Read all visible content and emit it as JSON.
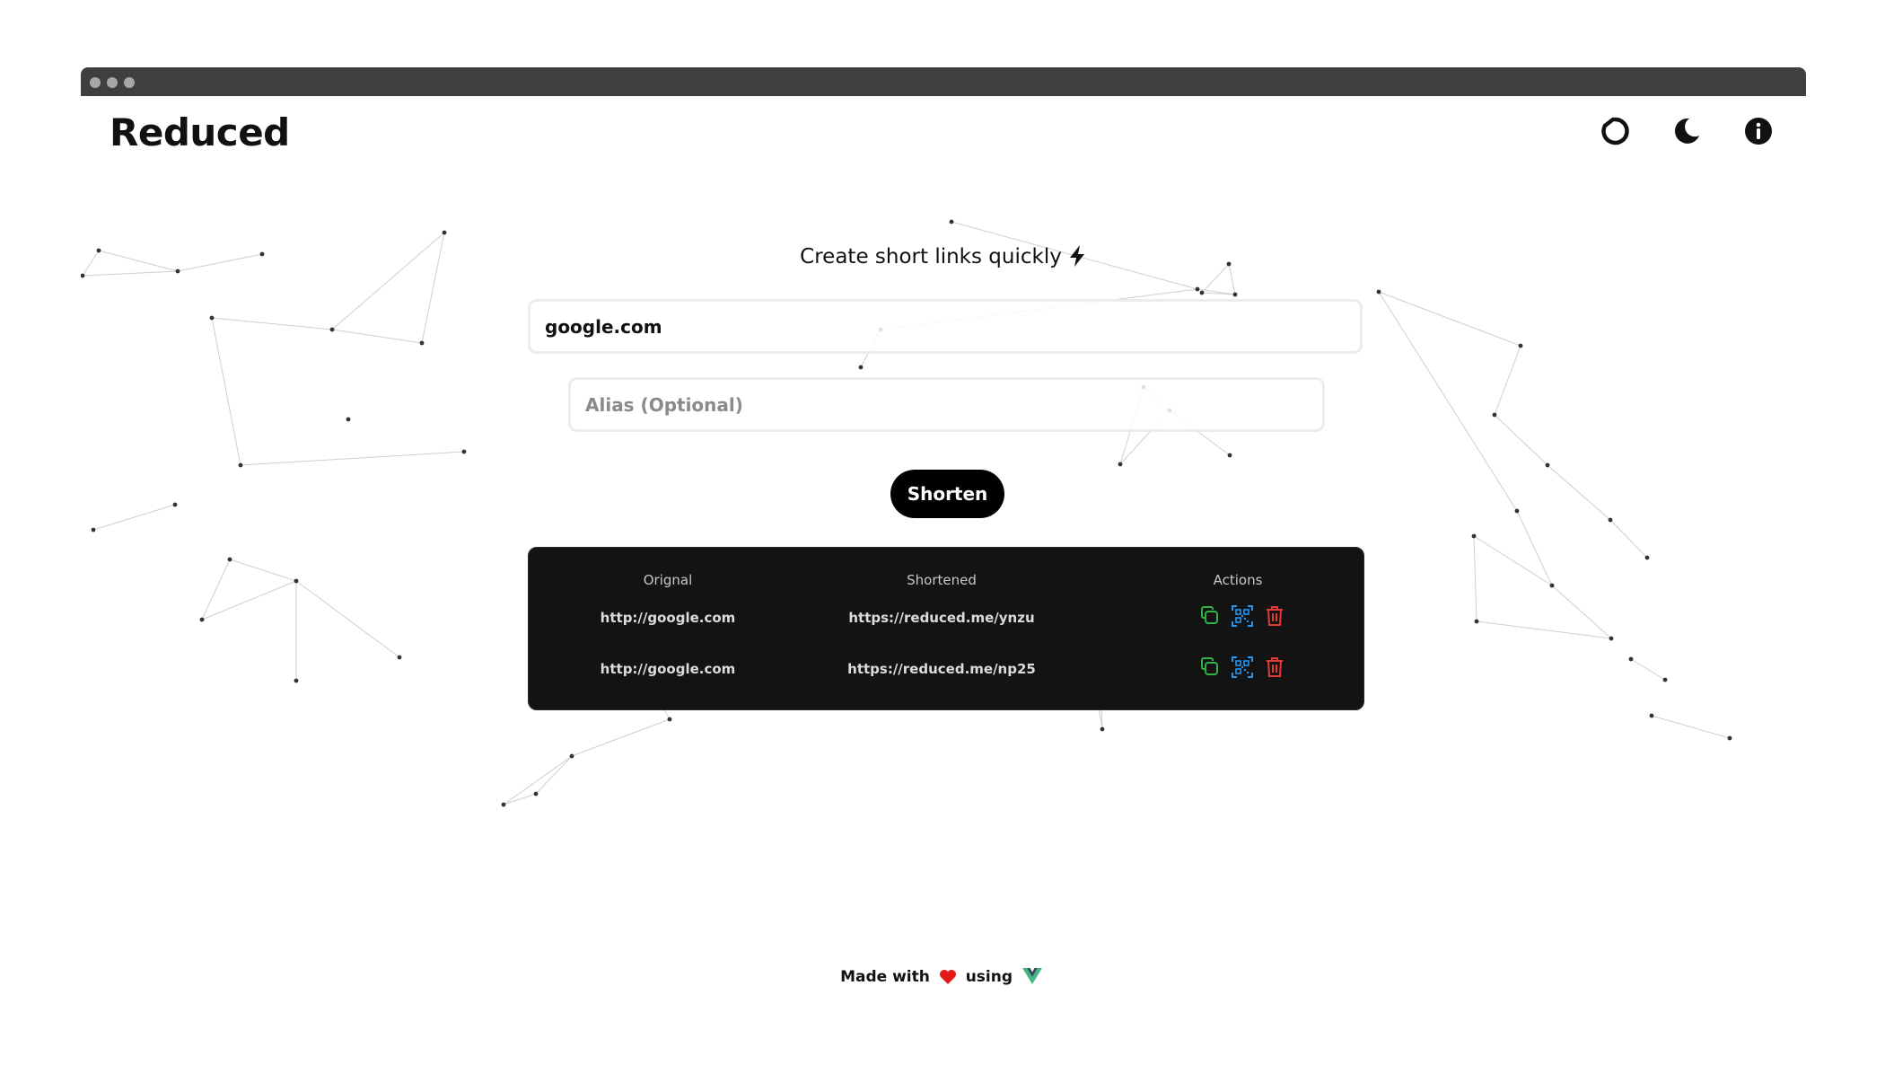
{
  "browser": {
    "window_dots": 3
  },
  "header": {
    "brand": "Reduced",
    "icons": [
      "refresh-icon",
      "moon-icon",
      "info-icon"
    ]
  },
  "hero": {
    "tagline": "Create short links quickly"
  },
  "form": {
    "url_value": "google.com",
    "alias_placeholder": "Alias (Optional)",
    "shorten_label": "Shorten"
  },
  "table": {
    "headers": {
      "original": "Orignal",
      "shortened": "Shortened",
      "actions": "Actions"
    },
    "rows": [
      {
        "original": "http://google.com",
        "shortened": "https://reduced.me/ynzu"
      },
      {
        "original": "http://google.com",
        "shortened": "https://reduced.me/np25"
      }
    ],
    "action_icons": [
      "copy-icon",
      "qr-code-icon",
      "trash-icon"
    ],
    "action_colors": {
      "copy": "#2fb344",
      "qr": "#2196f3",
      "delete": "#e53935"
    }
  },
  "footer": {
    "made_with": "Made with",
    "using": "using",
    "heart_color": "#e3191b",
    "vue_color": "#41b883"
  },
  "colors": {
    "panel": "#131313",
    "button": "#000000",
    "background": "#ffffff"
  }
}
